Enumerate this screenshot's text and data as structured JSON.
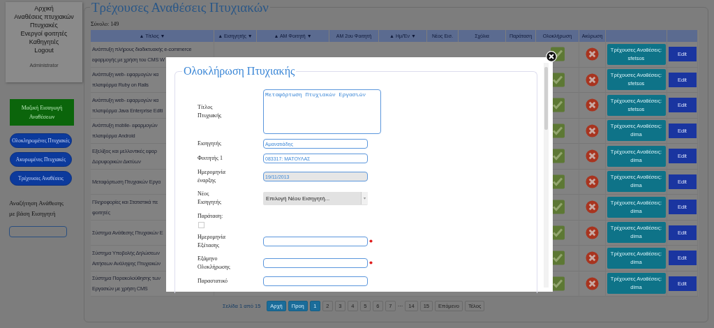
{
  "sidebar": {
    "menu": [
      "Αρχική",
      "Αναθέσεις πτυχιακών",
      "Πτυχιακές",
      "Ενεργοί φοιτητές",
      "Καθηγητές",
      "Logout"
    ],
    "role": "Administrator",
    "import_button": "Μαζική Εισαγωγή Αναθέσεων",
    "filter_buttons": [
      "Ολοκληρωμένες Πτυχιακές",
      "Ακυρωμένες Πτυχιακές",
      "Τρέχουσες Αναθέσεις"
    ],
    "search_label": "Αναζήτηση Ανάθεσης με βάση Εισηγητή"
  },
  "page": {
    "title": "Τρέχουσες Αναθέσεις Πτυχιακών",
    "total": "Σύνολο: 149"
  },
  "table": {
    "columns": [
      "▲ Τίτλος ▼",
      "▲ Εισηγητής ▼",
      "▲ ΑΜ Φοιτητή ▼",
      "ΑΜ 2ου Φοιτητή",
      "▲ Ημ/Έν ▼",
      "Νέος Εισ.",
      "Σχόλια",
      "Παράταση",
      "Ολοκλήρωση",
      "Ακύρωση"
    ],
    "rows": [
      {
        "title_lines": [
          "Ανάπτυξη πλήρους διαδικτυακής e-commerce",
          "εφαρμογής με χρήση του CMS W"
        ],
        "assignments_button": "Τρέχουσες Αναθέσεις: sfetsos",
        "edit_button": "Edit"
      },
      {
        "title_lines": [
          "Ανάπτυξη web- εφαρμογών κα",
          "πλατφόρμα Ruby on Rails"
        ],
        "assignments_button": "Τρέχουσες Αναθέσεις: sfetsos",
        "edit_button": "Edit"
      },
      {
        "title_lines": [
          "Ανάπτυξη web- εφαρμογών κα",
          "πλατφόρμα Java Enterprise Editi"
        ],
        "assignments_button": "Τρέχουσες Αναθέσεις: sfetsos",
        "edit_button": "Edit"
      },
      {
        "title_lines": [
          "Ανάπτυξη mobile- εφαρμογών",
          "πλατφόρμα Android"
        ],
        "assignments_button": "Τρέχουσες Αναθέσεις: dima",
        "edit_button": "Edit"
      },
      {
        "title_lines": [
          "Εξελίξεις και μελλοντικές εφαρ",
          "Δορυφορικών Δικτύων"
        ],
        "assignments_button": "Τρέχουσες Αναθέσεις: dima",
        "edit_button": "Edit"
      },
      {
        "title_lines": [
          "Μεταφόρτωση Πτυχιακών Εργα"
        ],
        "assignments_button": "Τρέχουσες Αναθέσεις: dima",
        "edit_button": "Edit"
      },
      {
        "title_lines": [
          "Πληροφορίες και Στατιστικά πε",
          "φοιτητές"
        ],
        "assignments_button": "Τρέχουσες Αναθέσεις: dima",
        "edit_button": "Edit"
      },
      {
        "title_lines": [
          "Σύστημα Ανάθεσης Πτυχιακών Ε"
        ],
        "assignments_button": "Τρέχουσες Αναθέσεις: dima",
        "edit_button": "Edit"
      },
      {
        "title_lines": [
          "Σύστημα Υποβολής Δηλώσεων",
          "Αιτήσεων Ανάληψης Πτυχιακών"
        ],
        "assignments_button": "Τρέχουσες Αναθέσεις: dima",
        "edit_button": "Edit"
      },
      {
        "title_lines": [
          "Σύστημα Παρακολούθησης των",
          "Εργασιών με χρήση CMS"
        ],
        "assignments_button": "Τρέχουσες Αναθέσεις: dima",
        "edit_button": "Edit"
      }
    ]
  },
  "pagination": {
    "summary": "Σελίδα 1 από 15",
    "items": [
      {
        "label": "Αρχή",
        "kind": "nav",
        "highlighted": true
      },
      {
        "label": "Προη",
        "kind": "nav",
        "highlighted": true
      },
      {
        "label": "1",
        "kind": "page",
        "highlighted": true
      },
      {
        "label": "2",
        "kind": "page",
        "highlighted": false
      },
      {
        "label": "3",
        "kind": "page",
        "highlighted": false
      },
      {
        "label": "4",
        "kind": "page",
        "highlighted": false
      },
      {
        "label": "5",
        "kind": "page",
        "highlighted": false
      },
      {
        "label": "6",
        "kind": "page",
        "highlighted": false
      },
      {
        "label": "7",
        "kind": "page",
        "highlighted": false
      },
      {
        "label": "···",
        "kind": "gap"
      },
      {
        "label": "14",
        "kind": "page",
        "highlighted": false
      },
      {
        "label": "15",
        "kind": "page",
        "highlighted": false
      },
      {
        "label": "Επόμενο",
        "kind": "nav",
        "highlighted": false
      },
      {
        "label": "Τέλος",
        "kind": "nav",
        "highlighted": false
      }
    ]
  },
  "modal": {
    "title": "Ολοκλήρωση Πτυχιακής",
    "fields": [
      {
        "label": "Τίτλος Πτυχιακής",
        "kind": "textarea",
        "value": "Μεταφόρτωση Πτυχιακών Εργασιών"
      },
      {
        "label": "Εισηγητής",
        "kind": "text",
        "value": "Αμανατιάδης",
        "disabled": false,
        "required": false
      },
      {
        "label": "Φοιτητής 1",
        "kind": "text",
        "value": "083317: ΜΑΤΟΥΛΑΣ",
        "disabled": false,
        "required": false
      },
      {
        "label": "Ημερομηνία έναρξης",
        "kind": "text",
        "value": "19/11/2013",
        "disabled": true,
        "required": false
      },
      {
        "label": "Νέος Εισηγητής",
        "kind": "select",
        "value": "Επιλογή Νέου Εισηγητή..."
      },
      {
        "label": "Παράταση:",
        "kind": "checkbox",
        "checked": false
      },
      {
        "label": "Ημερομηνία Εξέτασης",
        "kind": "text",
        "disabled": false,
        "required": true
      },
      {
        "label": "Εξάμηνο Ολοκλήρωσης",
        "kind": "text",
        "disabled": false,
        "required": true
      },
      {
        "label": "Παραστατικό",
        "kind": "text",
        "disabled": false,
        "required": false
      }
    ]
  }
}
